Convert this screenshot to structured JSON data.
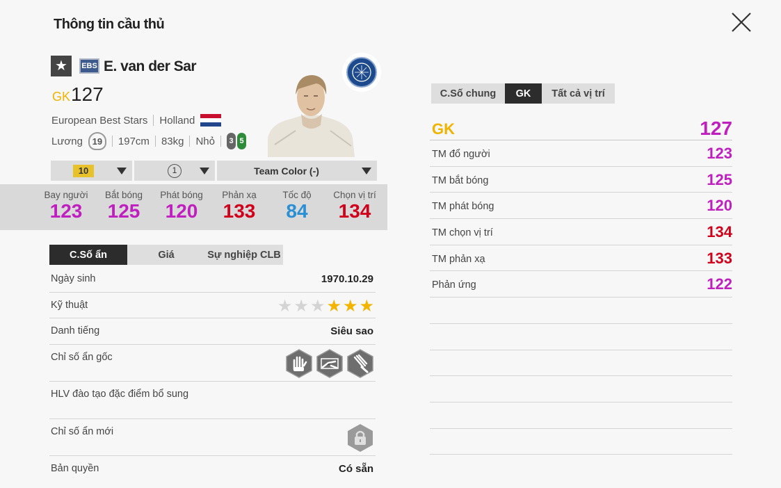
{
  "title": "Thông tin cầu thủ",
  "player": {
    "name": "E. van der Sar",
    "season": "EBS",
    "position": "GK",
    "ovr": "127",
    "team": "European Best Stars",
    "nation": "Holland",
    "salary_label": "Lương",
    "salary": "19",
    "height": "197cm",
    "weight": "83kg",
    "body": "Nhỏ",
    "weak_foot_left": "3",
    "weak_foot_right": "5"
  },
  "selects": {
    "level": "10",
    "team_color": "Team Color (-)",
    "trait": "1"
  },
  "stats": [
    {
      "label": "Bay người",
      "value": "123",
      "color": "#c01fbf"
    },
    {
      "label": "Bắt bóng",
      "value": "125",
      "color": "#c01fbf"
    },
    {
      "label": "Phát bóng",
      "value": "120",
      "color": "#c01fbf"
    },
    {
      "label": "Phản xạ",
      "value": "133",
      "color": "#d0021b"
    },
    {
      "label": "Tốc độ",
      "value": "84",
      "color": "#2b8fd6"
    },
    {
      "label": "Chọn vị trí",
      "value": "134",
      "color": "#d0021b"
    }
  ],
  "left_tabs": [
    "C.Số ẩn",
    "Giá",
    "Sự nghiệp CLB"
  ],
  "info": {
    "birth_label": "Ngày sinh",
    "birth": "1970.10.29",
    "skill_label": "Kỹ thuật",
    "skill_stars": 3,
    "fame_label": "Danh tiếng",
    "fame": "Siêu sao",
    "hidden_label": "Chỉ số ẩn gốc",
    "coach_label": "HLV đào tạo đặc điểm bổ sung",
    "new_hidden_label": "Chỉ số ẩn mới",
    "license_label": "Bản quyền",
    "license": "Có sẵn"
  },
  "right_tabs": [
    "C.Số chung",
    "GK",
    "Tất cả vị trí"
  ],
  "gk": {
    "label": "GK",
    "value": "127"
  },
  "gk_stats": [
    {
      "label": "TM đổ người",
      "value": "123",
      "color": "#c01fbf"
    },
    {
      "label": "TM bắt bóng",
      "value": "125",
      "color": "#c01fbf"
    },
    {
      "label": "TM phát bóng",
      "value": "120",
      "color": "#c01fbf"
    },
    {
      "label": "TM chọn vị trí",
      "value": "134",
      "color": "#d0021b"
    },
    {
      "label": "TM phản xạ",
      "value": "133",
      "color": "#d0021b"
    },
    {
      "label": "Phản ứng",
      "value": "122",
      "color": "#c01fbf"
    }
  ],
  "colors": {
    "gold": "#f0b400",
    "magenta": "#c01fbf",
    "red": "#d0021b",
    "blue": "#2b8fd6",
    "star_on": "#f3b400",
    "star_off": "#d4d4d4"
  },
  "icons": [
    "star-icon",
    "close-icon",
    "netherlands-flag-icon",
    "glove-icon",
    "dive-icon",
    "catch-icon",
    "lock-icon",
    "chevron-down-icon"
  ]
}
